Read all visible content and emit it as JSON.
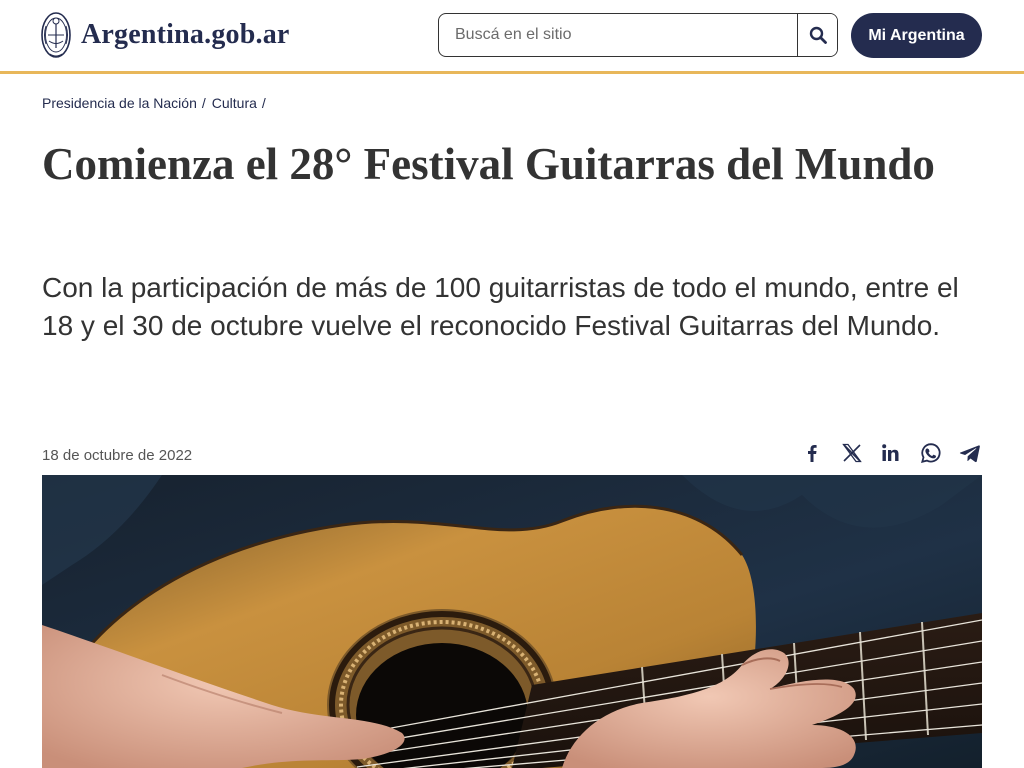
{
  "header": {
    "logo_text": "Argentina.gob.ar",
    "search_placeholder": "Buscá en el sitio",
    "search_icon": "search-icon",
    "mi_argentina_label": "Mi Argentina",
    "brand_color": "#242c4f",
    "accent_color": "#e8b75a"
  },
  "breadcrumb": {
    "items": [
      "Presidencia de la Nación",
      "Cultura"
    ],
    "separator": "/"
  },
  "article": {
    "title": "Comienza el 28° Festival Guitarras del Mundo",
    "lead": "Con la participación de más de 100 guitarristas de todo el mundo, entre el 18 y el 30 de octubre vuelve el reconocido Festival Guitarras del Mundo.",
    "date": "18 de octubre de 2022"
  },
  "share": {
    "icons": [
      "facebook-icon",
      "x-icon",
      "linkedin-icon",
      "whatsapp-icon",
      "telegram-icon"
    ]
  },
  "image": {
    "subject": "guitar-photo"
  }
}
